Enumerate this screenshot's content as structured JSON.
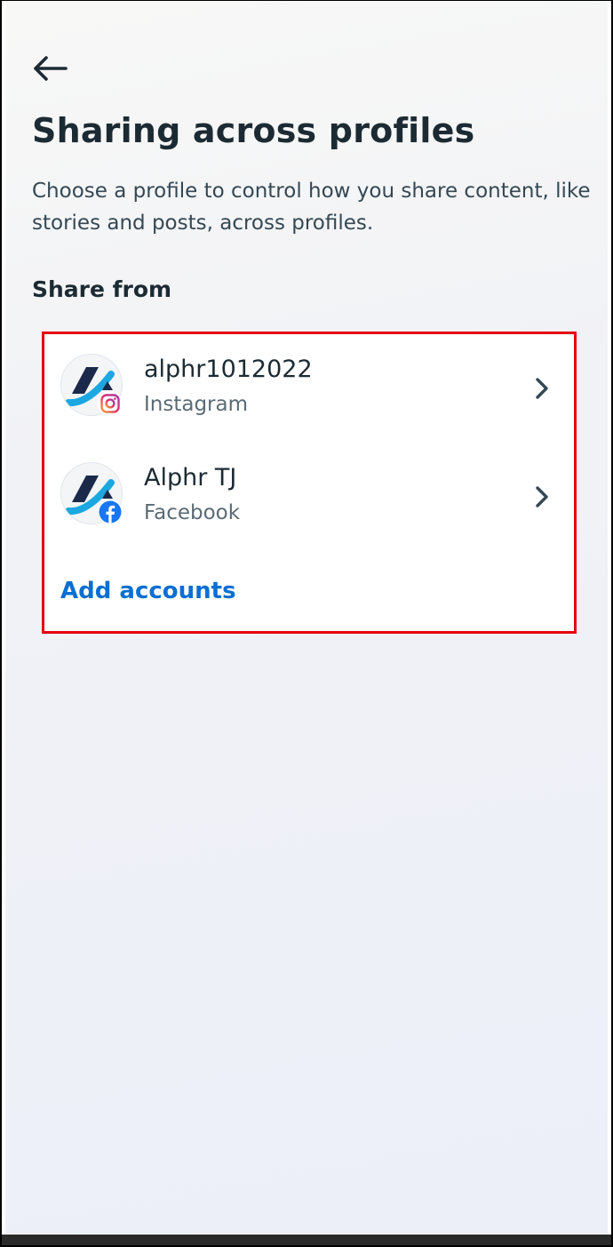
{
  "header": {
    "back_icon": "arrow-left-icon",
    "title": "Sharing across profiles",
    "description": "Choose a profile to control how you share content, like stories and posts, across profiles."
  },
  "share_from": {
    "heading": "Share from",
    "accounts": [
      {
        "name": "alphr1012022",
        "platform": "Instagram",
        "avatar_icon": "alphr-logo-icon",
        "badge_icon": "instagram-icon",
        "chevron_icon": "chevron-right-icon"
      },
      {
        "name": "Alphr TJ",
        "platform": "Facebook",
        "avatar_icon": "alphr-logo-icon",
        "badge_icon": "facebook-icon",
        "chevron_icon": "chevron-right-icon"
      }
    ],
    "add_accounts_label": "Add accounts"
  },
  "colors": {
    "title_text": "#1c2b33",
    "secondary_text": "#5b6b74",
    "link_blue": "#0a6fd1",
    "highlight_red": "#e3000f",
    "facebook_blue": "#1877f2"
  }
}
